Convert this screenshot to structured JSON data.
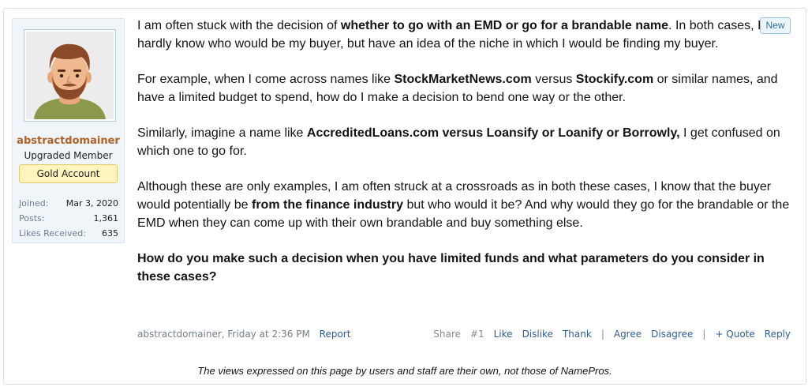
{
  "sidebar": {
    "username": "abstractdomainer",
    "user_title": "Upgraded Member",
    "account_badge": "Gold Account",
    "stats": [
      {
        "label": "Joined:",
        "value": "Mar 3, 2020"
      },
      {
        "label": "Posts:",
        "value": "1,361"
      },
      {
        "label": "Likes Received:",
        "value": "635"
      }
    ]
  },
  "post": {
    "new_label": "New",
    "p1_a": "I am often stuck with the decision of ",
    "p1_b": "whether to go with an EMD or go for a brandable name",
    "p1_c": ". In both cases, I hardly know who would be my buyer, but have an idea of the niche in which I would be finding my buyer.",
    "p2_a": "For example, when I come across names like ",
    "p2_b": "StockMarketNews.com",
    "p2_c": " versus ",
    "p2_d": "Stockify.com",
    "p2_e": " or similar names, and have a limited budget to spend, how do I make a decision to bend one way or the other.",
    "p3_a": "Similarly, imagine a name like ",
    "p3_b": "AccreditedLoans.com versus Loansify or Loanify or Borrowly,",
    "p3_c": " I get confused on which one to go for.",
    "p4_a": "Although these are only examples, I am often struck at a crossroads as in both these cases, I know that the buyer would potentially be ",
    "p4_b": "from the finance industry",
    "p4_c": " but who would it be? And why would they go for the brandable or the EMD when they can come up with their own brandable and buy something else.",
    "p5": "How do you make such a decision when you have limited funds and what parameters do you consider in these cases?"
  },
  "footer": {
    "author_time": "abstractdomainer, Friday at 2:36 PM",
    "report": "Report",
    "share": "Share",
    "post_number": "#1",
    "like": "Like",
    "dislike": "Dislike",
    "thank": "Thank",
    "separator": "|",
    "agree": "Agree",
    "disagree": "Disagree",
    "quote": "+ Quote",
    "reply": "Reply"
  },
  "disclaimer": "The views expressed on this page by users and staff are their own, not those of NamePros."
}
